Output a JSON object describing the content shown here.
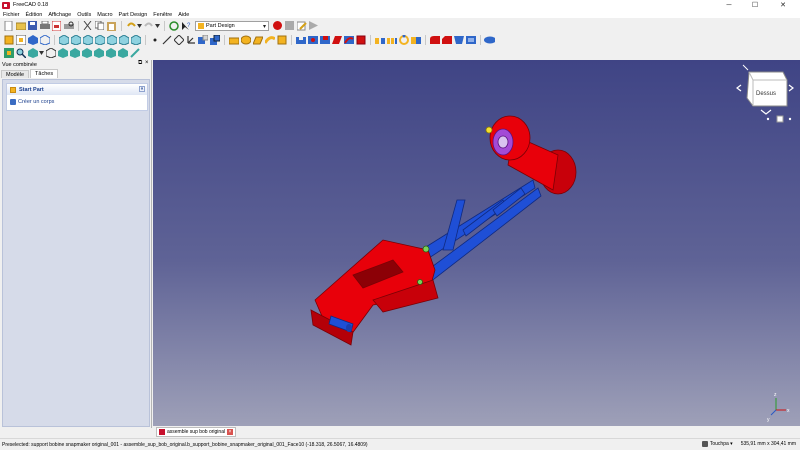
{
  "window": {
    "title": "FreeCAD 0.18",
    "controls": {
      "minimize": "─",
      "maximize": "☐",
      "close": "✕"
    }
  },
  "menu": [
    "Fichier",
    "Édition",
    "Affichage",
    "Outils",
    "Macro",
    "Part Design",
    "Fenêtre",
    "Aide"
  ],
  "toolbar": {
    "workbench_selected": "Part Design"
  },
  "combo_view": {
    "title": "Vue combinée",
    "tabs": [
      "Modèle",
      "Tâches"
    ],
    "active_tab": "Tâches",
    "task": {
      "header": "Start Part",
      "collapse_glyph": "«",
      "item": "Créer un corps"
    }
  },
  "navigation_cube": {
    "face_label": "Dessus"
  },
  "axis_indicator": {
    "x": "x",
    "y": "y",
    "z": "z"
  },
  "document_tab": {
    "label": "assemble sup bob original : 1",
    "close_glyph": "×"
  },
  "statusbar": {
    "message": "Preselected: support bobine snapmaker original_001 - assemble_sup_bob_original.b_support_bobine_snapmaker_original_001_Face10 (-18.318, 26.5067, 16.4809)",
    "navigation_style": "Touchpa",
    "dimensions": "535,91 mm x 304,41 mm"
  },
  "colors": {
    "part_red": "#e8000a",
    "part_blue": "#1f4fd6",
    "accent_purple": "#a34ad6",
    "view_top": "#3f4485",
    "view_bottom": "#9ea0b8"
  }
}
